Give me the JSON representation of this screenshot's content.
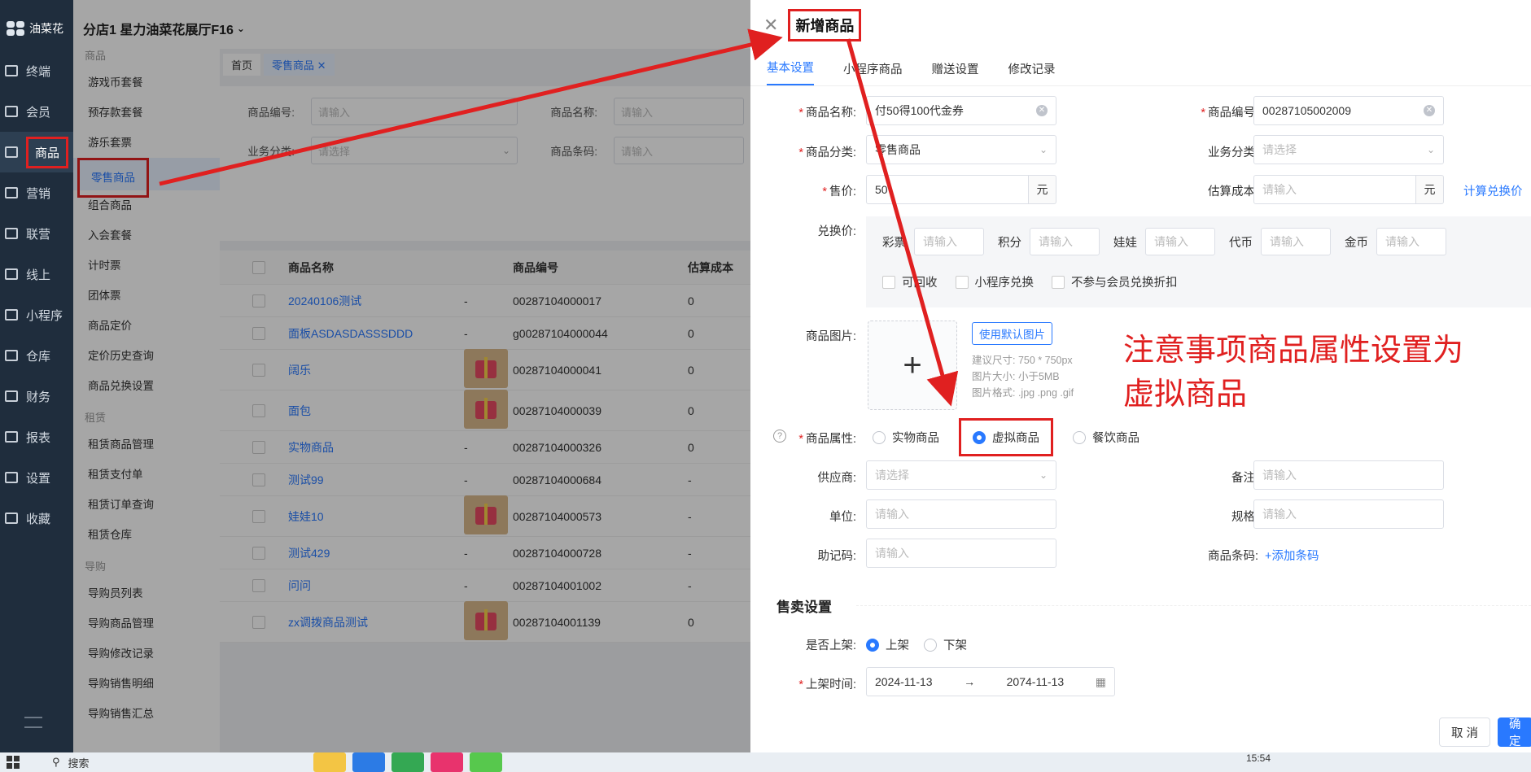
{
  "sidebar": {
    "logo": "油菜花",
    "items": [
      {
        "label": "终端",
        "icon": "terminal-icon"
      },
      {
        "label": "会员",
        "icon": "member-icon"
      },
      {
        "label": "商品",
        "icon": "goods-icon"
      },
      {
        "label": "营销",
        "icon": "flag-icon"
      },
      {
        "label": "联营",
        "icon": "partner-icon"
      },
      {
        "label": "线上",
        "icon": "online-icon"
      },
      {
        "label": "小程序",
        "icon": "miniprogram-icon"
      },
      {
        "label": "仓库",
        "icon": "warehouse-icon"
      },
      {
        "label": "财务",
        "icon": "finance-icon"
      },
      {
        "label": "报表",
        "icon": "report-icon"
      },
      {
        "label": "设置",
        "icon": "gear-icon"
      },
      {
        "label": "收藏",
        "icon": "heart-icon"
      }
    ]
  },
  "header": {
    "store": "分店1 星力油菜花展厅F16"
  },
  "submenu": {
    "group1": "商品",
    "items1": [
      "游戏币套餐",
      "预存款套餐",
      "游乐套票",
      "零售商品",
      "组合商品",
      "入会套餐",
      "计时票",
      "团体票",
      "商品定价",
      "定价历史查询",
      "商品兑换设置"
    ],
    "group2": "租赁",
    "items2": [
      "租赁商品管理",
      "租赁支付单",
      "租赁订单查询",
      "租赁仓库"
    ],
    "group3": "导购",
    "items3": [
      "导购员列表",
      "导购商品管理",
      "导购修改记录",
      "导购销售明细",
      "导购销售汇总"
    ]
  },
  "tabs": [
    "首页",
    "零售商品"
  ],
  "filters": {
    "code_label": "商品编号:",
    "code_ph": "请输入",
    "name_label": "商品名称:",
    "name_ph": "请输入",
    "biz_label": "业务分类:",
    "biz_ph": "请选择",
    "barcode_label": "商品条码:",
    "barcode_ph": "请输入"
  },
  "table": {
    "headers": [
      "商品名称",
      "商品编号",
      "估算成本"
    ],
    "rows": [
      {
        "name": "20240106测试",
        "img": "-",
        "code": "00287104000017",
        "cost": "0"
      },
      {
        "name": "面板ASDASDASSSDDD",
        "img": "-",
        "code": "g00287104000044",
        "cost": "0"
      },
      {
        "name": "阔乐",
        "img": "gift",
        "code": "00287104000041",
        "cost": "0"
      },
      {
        "name": "面包",
        "img": "gift",
        "code": "00287104000039",
        "cost": "0"
      },
      {
        "name": "实物商品",
        "img": "-",
        "code": "00287104000326",
        "cost": "0"
      },
      {
        "name": "测试99",
        "img": "-",
        "code": "00287104000684",
        "cost": "-"
      },
      {
        "name": "娃娃10",
        "img": "gift",
        "code": "00287104000573",
        "cost": "-"
      },
      {
        "name": "测试429",
        "img": "-",
        "code": "00287104000728",
        "cost": "-"
      },
      {
        "name": "问问",
        "img": "-",
        "code": "00287104001002",
        "cost": "-"
      },
      {
        "name": "zx调拨商品测试",
        "img": "gift",
        "code": "00287104001139",
        "cost": "0"
      }
    ]
  },
  "drawer": {
    "title": "新增商品",
    "tabs": [
      "基本设置",
      "小程序商品",
      "赠送设置",
      "修改记录"
    ],
    "name_label": "商品名称:",
    "name_value": "付50得100代金券",
    "code_label": "商品编号:",
    "code_value": "00287105002009",
    "cat_label": "商品分类:",
    "cat_value": "零售商品",
    "biz_label": "业务分类:",
    "biz_ph": "请选择",
    "price_label": "售价:",
    "price_value": "50",
    "unit_yuan": "元",
    "cost_label": "估算成本:",
    "cost_ph": "请输入",
    "calc_link": "计算兑换价",
    "exchange_label": "兑换价:",
    "exchange": [
      {
        "label": "彩票",
        "ph": "请输入"
      },
      {
        "label": "积分",
        "ph": "请输入"
      },
      {
        "label": "娃娃",
        "ph": "请输入"
      },
      {
        "label": "代币",
        "ph": "请输入"
      },
      {
        "label": "金币",
        "ph": "请输入"
      }
    ],
    "checks": [
      "可回收",
      "小程序兑换",
      "不参与会员兑换折扣"
    ],
    "img_label": "商品图片:",
    "default_img_btn": "使用默认图片",
    "hint1": "建议尺寸: 750 * 750px",
    "hint2": "图片大小: 小于5MB",
    "hint3": "图片格式: .jpg .png .gif",
    "note_line1": "注意事项商品属性设置为",
    "note_line2": "虚拟商品",
    "attr_label": "商品属性:",
    "attr_options": [
      "实物商品",
      "虚拟商品",
      "餐饮商品"
    ],
    "supplier_label": "供应商:",
    "supplier_ph": "请选择",
    "remark_label": "备注:",
    "remark_ph": "请输入",
    "unit_label": "单位:",
    "unit_ph": "请输入",
    "spec_label": "规格:",
    "spec_ph": "请输入",
    "mnemonic_label": "助记码:",
    "mnemonic_ph": "请输入",
    "barcode_label": "商品条码:",
    "barcode_link": "+添加条码",
    "sale_section": "售卖设置",
    "onshelf_label": "是否上架:",
    "on": "上架",
    "off": "下架",
    "time_label": "上架时间:",
    "time_start": "2024-11-13",
    "time_arrow": "→",
    "time_end": "2074-11-13",
    "cancel": "取 消",
    "ok": "确 定"
  },
  "taskbar": {
    "search": "搜索",
    "time": "15:54"
  }
}
